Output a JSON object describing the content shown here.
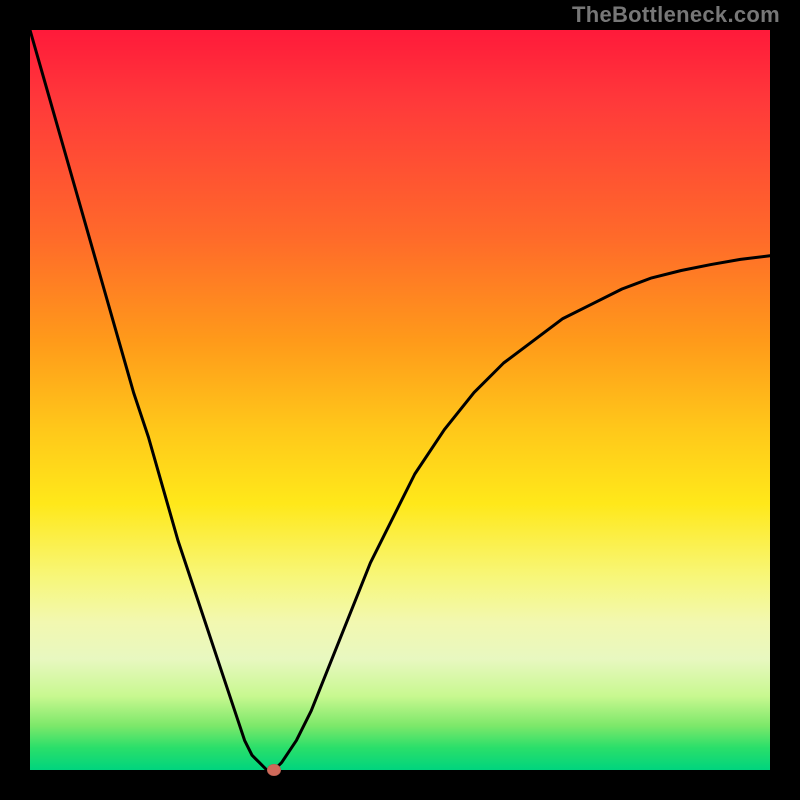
{
  "watermark": "TheBottleneck.com",
  "colors": {
    "frame": "#000000",
    "curve": "#000000",
    "marker": "#cf6a5a",
    "gradient_stops": [
      "#ff1a3a",
      "#ff6a2a",
      "#ffc81a",
      "#f7f77a",
      "#7de86a",
      "#00d47e"
    ]
  },
  "chart_data": {
    "type": "line",
    "title": "",
    "xlabel": "",
    "ylabel": "",
    "xlim": [
      0,
      100
    ],
    "ylim": [
      0,
      100
    ],
    "x": [
      0,
      2,
      4,
      6,
      8,
      10,
      12,
      14,
      16,
      18,
      20,
      22,
      24,
      26,
      28,
      29,
      30,
      31,
      32,
      33,
      34,
      36,
      38,
      40,
      42,
      44,
      46,
      48,
      50,
      52,
      56,
      60,
      64,
      68,
      72,
      76,
      80,
      84,
      88,
      92,
      96,
      100
    ],
    "y": [
      100,
      93,
      86,
      79,
      72,
      65,
      58,
      51,
      45,
      38,
      31,
      25,
      19,
      13,
      7,
      4,
      2,
      1,
      0,
      0,
      1,
      4,
      8,
      13,
      18,
      23,
      28,
      32,
      36,
      40,
      46,
      51,
      55,
      58,
      61,
      63,
      65,
      66.5,
      67.5,
      68.3,
      69,
      69.5
    ],
    "marker": {
      "x": 33,
      "y": 0
    },
    "grid": false,
    "legend": false
  }
}
